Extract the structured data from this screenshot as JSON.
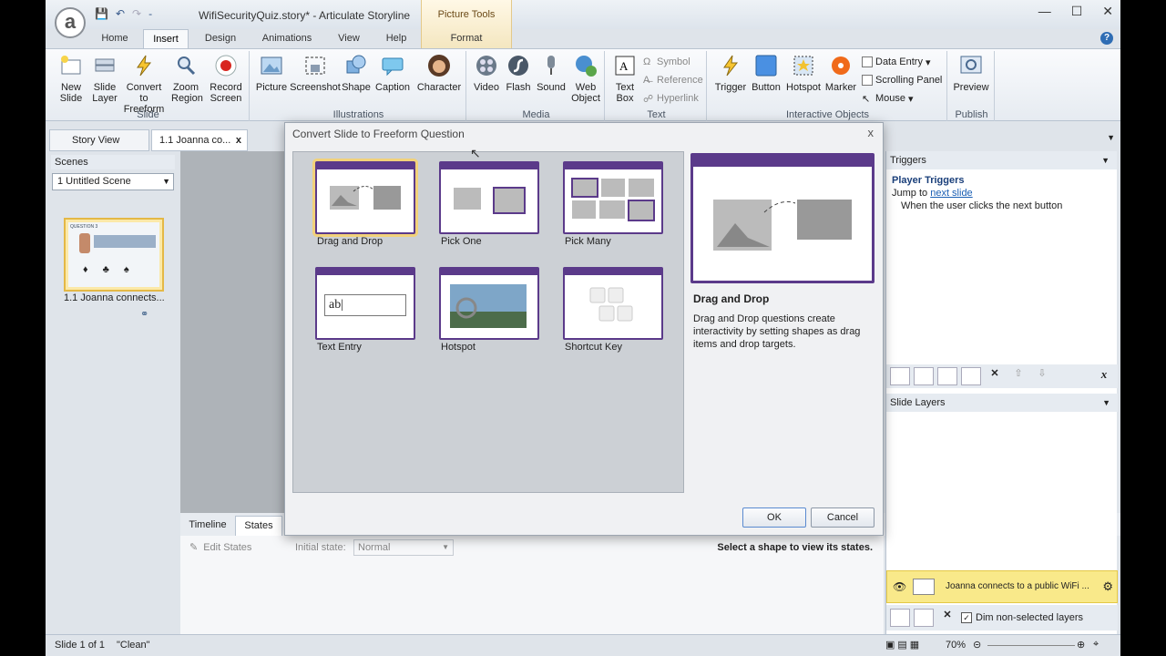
{
  "title": {
    "qat_more": "‑",
    "window_title": "WifiSecurityQuiz.story* - Articulate Storyline",
    "context_tab_group": "Picture Tools",
    "logo_letter": "a",
    "min": "—",
    "max": "☐",
    "close": "✕"
  },
  "tabs": [
    "Home",
    "Insert",
    "Design",
    "Animations",
    "View",
    "Help",
    "Format"
  ],
  "ribbon": {
    "slide_group": {
      "label": "Slide",
      "buttons": [
        "New Slide",
        "Slide Layer",
        "Convert to Freeform",
        "Zoom Region",
        "Record Screen"
      ]
    },
    "illustrations_group": {
      "label": "Illustrations",
      "buttons": [
        "Picture",
        "Screenshot",
        "Shape",
        "Caption",
        "Character"
      ]
    },
    "media_group": {
      "label": "Media",
      "buttons": [
        "Video",
        "Flash",
        "Sound",
        "Web Object"
      ]
    },
    "text_group": {
      "label": "Text",
      "big": "Text Box",
      "small": [
        "Symbol",
        "Reference",
        "Hyperlink"
      ]
    },
    "interactive_group": {
      "label": "Interactive Objects",
      "buttons": [
        "Trigger",
        "Button",
        "Hotspot",
        "Marker"
      ],
      "small": [
        "Data Entry",
        "Scrolling Panel",
        "Mouse"
      ]
    },
    "publish_group": {
      "label": "Publish",
      "buttons": [
        "Preview"
      ]
    }
  },
  "doc_tabs": {
    "story_view": "Story View",
    "current": "1.1 Joanna co...",
    "close": "x"
  },
  "scenes": {
    "header": "Scenes",
    "selected": "1 Untitled Scene",
    "thumb_label": "1.1 Joanna connects...",
    "thumb_title": "QUESTION 3"
  },
  "dialog": {
    "title": "Convert Slide to Freeform Question",
    "close": "x",
    "options": [
      "Drag and Drop",
      "Pick One",
      "Pick Many",
      "Text Entry",
      "Hotspot",
      "Shortcut Key"
    ],
    "text_entry_sample": "ab",
    "selected_title": "Drag and Drop",
    "selected_desc": "Drag and Drop questions create interactivity by setting shapes as drag items and drop targets.",
    "ok": "OK",
    "cancel": "Cancel"
  },
  "bottom": {
    "timeline": "Timeline",
    "states": "States",
    "edit_states": "Edit States",
    "initial_state_label": "Initial state:",
    "initial_state_value": "Normal",
    "hint": "Select a shape to view its states."
  },
  "triggers": {
    "header": "Triggers",
    "player_triggers": "Player Triggers",
    "jump_to": "Jump to",
    "link": "next slide",
    "when": "When the user clicks the next button"
  },
  "layers": {
    "header": "Slide Layers",
    "base_layer": "Joanna connects to a public WiFi ...",
    "dim_label": "Dim non-selected layers"
  },
  "status": {
    "slide": "Slide 1 of 1",
    "theme": "\"Clean\"",
    "zoom": "70%"
  },
  "colors": {
    "accent": "#5b3a8a",
    "selection": "#f2d27a",
    "link": "#1a5fb4"
  }
}
